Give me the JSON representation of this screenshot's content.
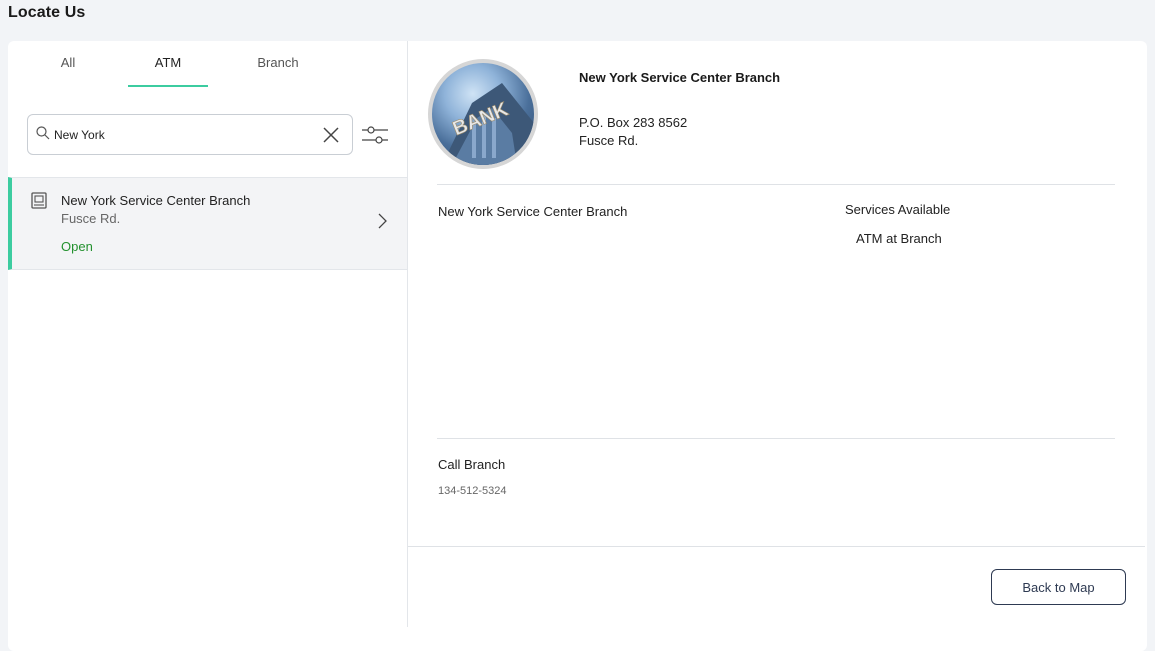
{
  "header": {
    "title": "Locate Us"
  },
  "tabs": [
    {
      "label": "All",
      "active": false
    },
    {
      "label": "ATM",
      "active": true
    },
    {
      "label": "Branch",
      "active": false
    }
  ],
  "search": {
    "value": "New York",
    "placeholder": ""
  },
  "results": [
    {
      "name": "New York Service Center Branch",
      "address": "Fusce Rd.",
      "status": "Open",
      "icon": "atm-icon"
    }
  ],
  "detail": {
    "title": "New York Service Center Branch",
    "address_line1": "P.O. Box 283 8562",
    "address_line2": "Fusce Rd.",
    "name": "New York Service Center Branch",
    "services_title": "Services Available",
    "services": [
      "ATM at Branch"
    ],
    "call_label": "Call Branch",
    "phone": "134-512-5324",
    "image_text": "BANK"
  },
  "footer": {
    "back_label": "Back to Map"
  },
  "colors": {
    "accent": "#3ccca0",
    "open": "#23912e",
    "button_border": "#2e3a52",
    "background": "#f2f4f7"
  }
}
